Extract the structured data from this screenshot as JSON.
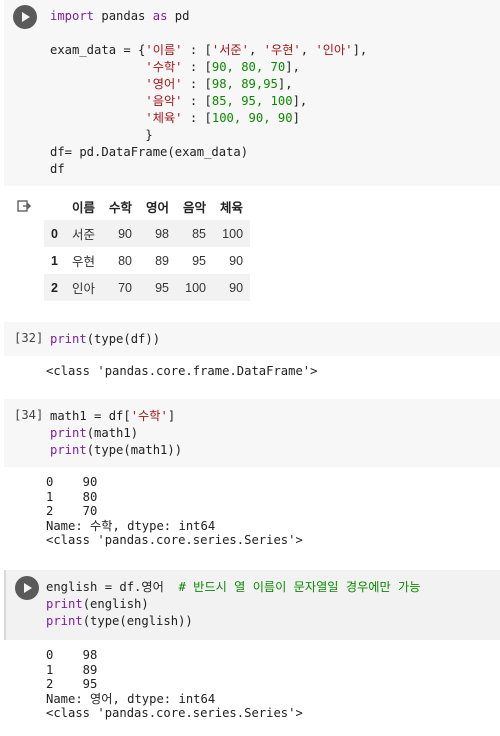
{
  "cell1": {
    "line1": [
      "import",
      " pandas ",
      "as",
      " pd"
    ],
    "line2_a": "exam_data = {",
    "line2_b": "'이름'",
    "line2_c": " : [",
    "line2_d": "'서준'",
    "line2_e": ", ",
    "line2_f": "'우현'",
    "line2_g": ", ",
    "line2_h": "'인아'",
    "line2_i": "],",
    "rows": [
      {
        "key": "'수학'",
        "mid": " : [",
        "vals": "90, 80, 70",
        "end": "],"
      },
      {
        "key": "'영어'",
        "mid": " : [",
        "vals": "98, 89,95",
        "end": "],"
      },
      {
        "key": "'음악'",
        "mid": " : [",
        "vals": "85, 95, 100",
        "end": "],"
      },
      {
        "key": "'체육'",
        "mid": " : [",
        "vals": "100, 90, 90",
        "end": "]"
      }
    ],
    "close": "}",
    "line8": "df= pd.DataFrame(exam_data)",
    "line9": "df"
  },
  "table": {
    "headers": [
      "",
      "이름",
      "수학",
      "영어",
      "음악",
      "체육"
    ],
    "rows": [
      [
        "0",
        "서준",
        "90",
        "98",
        "85",
        "100"
      ],
      [
        "1",
        "우현",
        "80",
        "89",
        "95",
        "90"
      ],
      [
        "2",
        "인아",
        "70",
        "95",
        "100",
        "90"
      ]
    ]
  },
  "cell2": {
    "count": "[32]",
    "fn": "print",
    "rest": "(type(df))",
    "output": "<class 'pandas.core.frame.DataFrame'>"
  },
  "cell3": {
    "count": "[34]",
    "l1a": "math1 = df[",
    "l1b": "'수학'",
    "l1c": "]",
    "l2fn": "print",
    "l2rest": "(math1)",
    "l3fn": "print",
    "l3rest": "(type(math1))",
    "output": "0    90\n1    80\n2    70\nName: 수학, dtype: int64\n<class 'pandas.core.series.Series'>"
  },
  "cell4": {
    "l1a": "english = df.영어  ",
    "l1comment": "# 반드시 열 이름이 문자열일 경우에만 가능",
    "l2fn": "print",
    "l2rest": "(english)",
    "l3fn": "print",
    "l3rest": "(type(english))",
    "output": "0    98\n1    89\n2    95\nName: 영어, dtype: int64\n<class 'pandas.core.series.Series'>"
  },
  "colors": {
    "keyword": "#7b1fa2",
    "string": "#a31515",
    "number": "#0b8a00",
    "comment": "#0b8a00"
  },
  "icons": {
    "run": "play-circle-icon",
    "output": "output-arrow-icon"
  }
}
